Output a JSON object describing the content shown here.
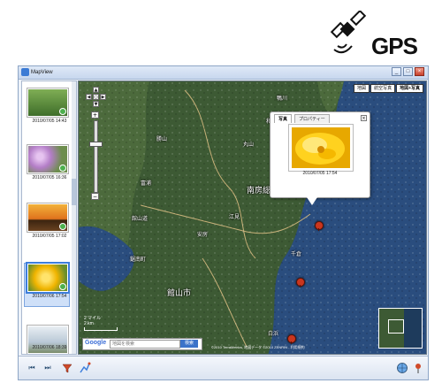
{
  "header": {
    "gps_label": "GPS",
    "icon": "satellite-icon"
  },
  "window": {
    "title": "MapView",
    "buttons": {
      "minimize": "_",
      "maximize": "□",
      "close": "×"
    }
  },
  "sidebar": {
    "items": [
      {
        "label": "2010/07/05 14:43",
        "kind": "green"
      },
      {
        "label": "2010/07/05 16:36",
        "kind": "flowers"
      },
      {
        "label": "2010/07/05 17:02",
        "kind": "sunset"
      },
      {
        "label": "2010/07/06 17:54",
        "kind": "yellow-flower",
        "selected": true
      },
      {
        "label": "2010/07/06 18:39",
        "kind": "cloudy"
      }
    ]
  },
  "map": {
    "map_types": [
      "地図",
      "航空写真",
      "地図+写真"
    ],
    "active_type": "地図+写真",
    "nav": {
      "up": "▲",
      "down": "▼",
      "left": "◀",
      "right": "▶",
      "center": "○",
      "zoom_in": "+",
      "zoom_out": "−"
    },
    "popup": {
      "tabs": [
        "写真",
        "プロパティー"
      ],
      "close": "×",
      "caption": "2010/07/05 17:54"
    },
    "labels": {
      "city_center": "南房総市",
      "city_left": "館山市",
      "area_nw": "鋸南町",
      "label_1": "勝山",
      "label_2": "千倉",
      "label_3": "白浜",
      "label_4": "和田",
      "label_5": "丸山",
      "label_6": "富浦",
      "label_7": "安房",
      "label_8": "江見",
      "label_9": "鴨川",
      "label_10": "館山道"
    },
    "scale": {
      "mi": "2 マイル",
      "km": "2 km"
    },
    "search": {
      "logo": "Google",
      "placeholder": "地図を検索",
      "button": "検索"
    },
    "copyright": "©2010 TerraMetrics, 地図データ ©2010 ZENRIN - 利用規約"
  },
  "toolbar": {
    "prev": "⏮",
    "next": "⏭",
    "tools": [
      "filter-icon",
      "route-icon"
    ],
    "right": [
      "globe-icon",
      "pin-icon"
    ]
  },
  "colors": {
    "water": "#2a4d7e",
    "land": "#3d5a34",
    "accent": "#3d7edb",
    "pin": "#c9361e"
  }
}
